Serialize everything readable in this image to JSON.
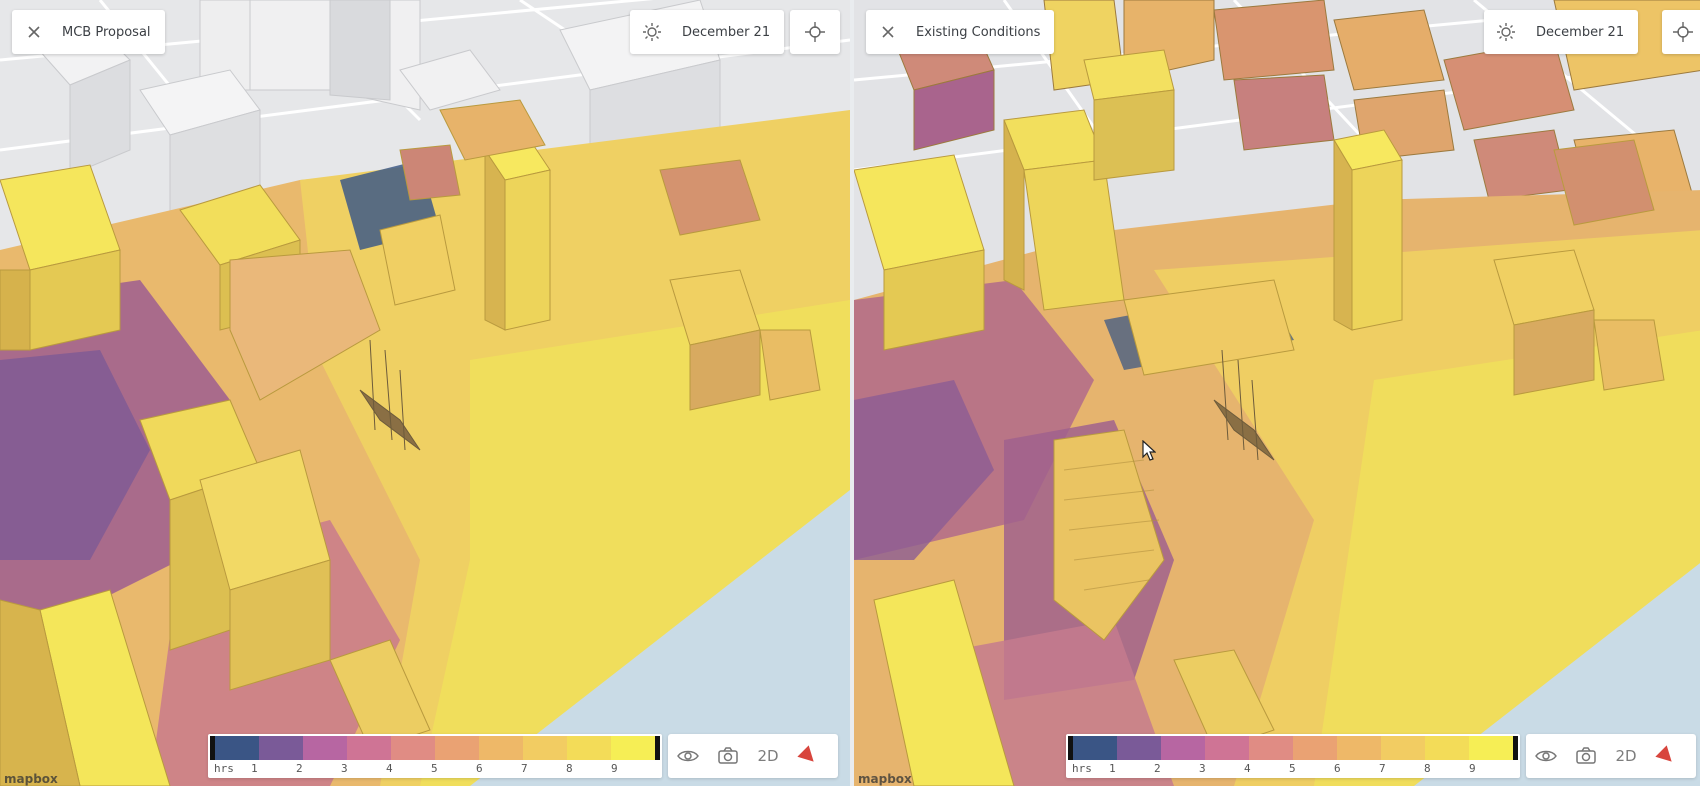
{
  "left_panel": {
    "title": "MCB Proposal",
    "date": "December 21",
    "attribution": "mapbox"
  },
  "right_panel": {
    "title": "Existing Conditions",
    "date": "December 21",
    "attribution": "mapbox"
  },
  "legend": {
    "unit": "hrs",
    "ticks": [
      "1",
      "2",
      "3",
      "4",
      "5",
      "6",
      "7",
      "8",
      "9"
    ],
    "colors": [
      "#3a5585",
      "#7a5a98",
      "#b766a2",
      "#cf7495",
      "#e08c84",
      "#eaa273",
      "#eeb868",
      "#f2cc62",
      "#f3dc58",
      "#f6ee55"
    ]
  },
  "toolbar": {
    "view_icon": "eye-icon",
    "camera_icon": "camera-icon",
    "mode_label": "2D",
    "compass_icon": "compass-icon"
  },
  "icons": {
    "close": "close-icon",
    "sun": "sun-icon",
    "locate": "crosshair-icon"
  },
  "colors": {
    "sun_full": "#f0e05a",
    "sun_mid": "#e3a56e",
    "shade_purple": "#9a5f8c",
    "shade_blue": "#3e5a86",
    "water": "#c9dbe6",
    "building_grey": "#e4e5e7",
    "compass_red": "#d8453d"
  }
}
